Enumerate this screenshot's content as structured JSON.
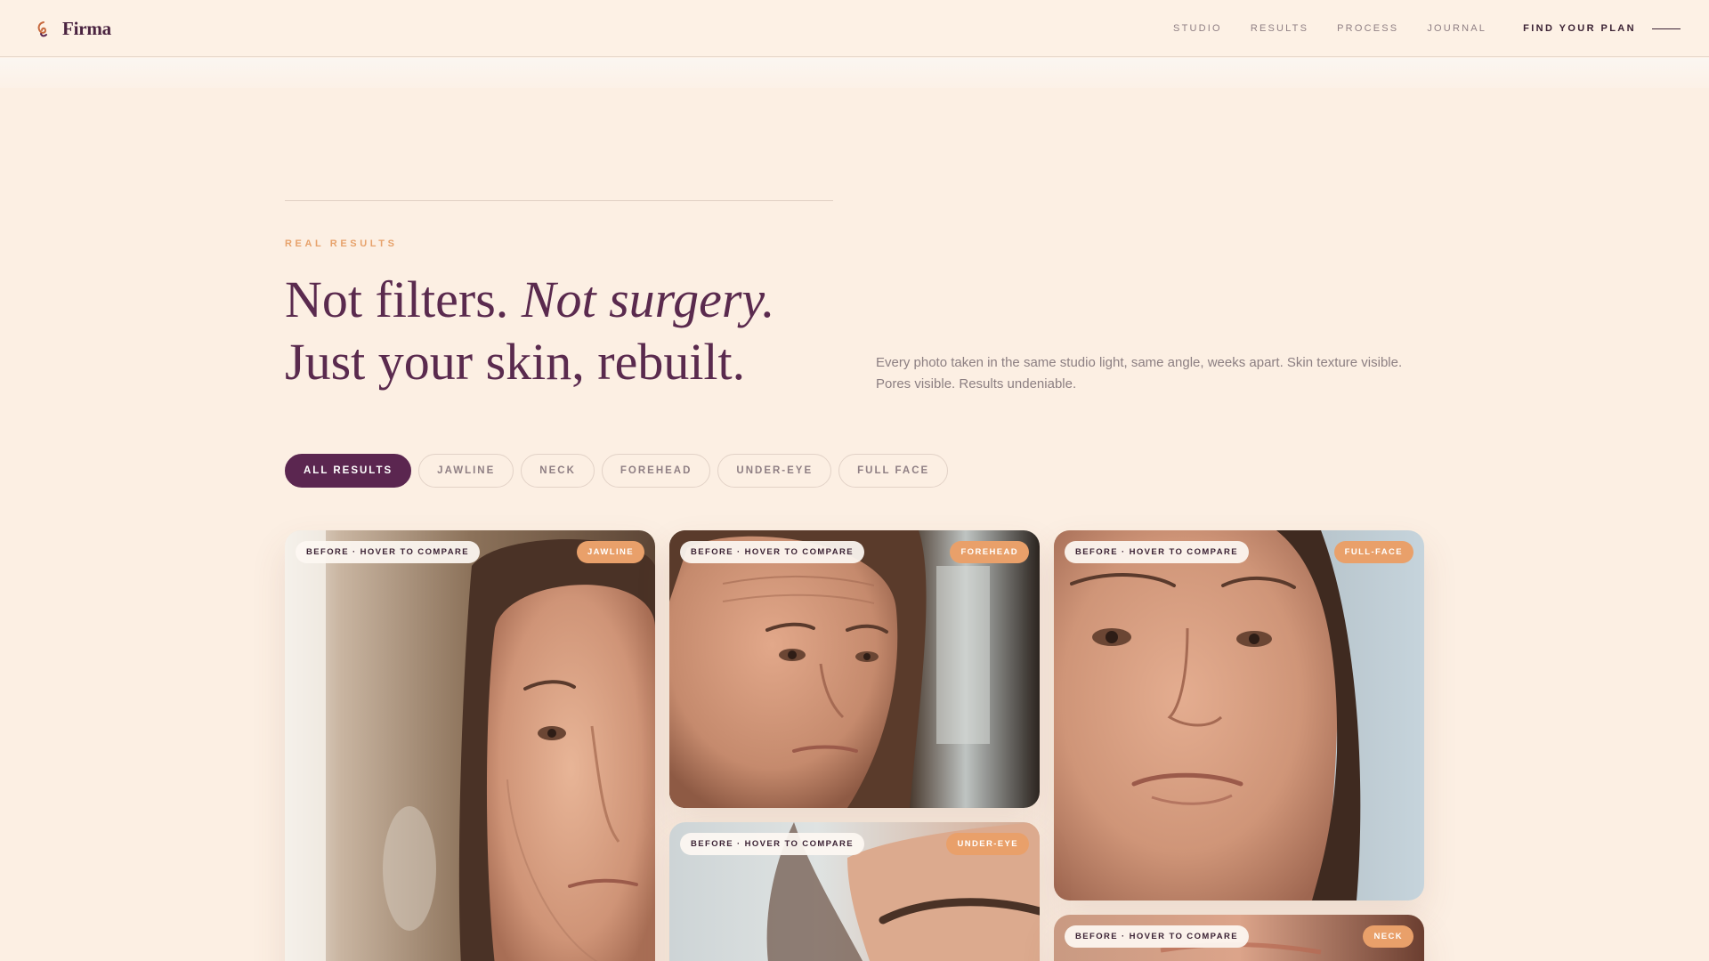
{
  "header": {
    "brand": "Firma",
    "nav": [
      "STUDIO",
      "RESULTS",
      "PROCESS",
      "JOURNAL"
    ],
    "cta": "FIND YOUR PLAN"
  },
  "hero": {
    "eyebrow": "REAL RESULTS",
    "headline_part1": "Not filters. ",
    "headline_italic": "Not surgery.",
    "headline_line2": "Just your skin, rebuilt.",
    "lede": "Every photo taken in the same studio light, same angle, weeks apart. Skin texture visible. Pores visible. Results undeniable."
  },
  "filters": [
    {
      "label": "ALL RESULTS",
      "active": true
    },
    {
      "label": "JAWLINE",
      "active": false
    },
    {
      "label": "NECK",
      "active": false
    },
    {
      "label": "FOREHEAD",
      "active": false
    },
    {
      "label": "UNDER-EYE",
      "active": false
    },
    {
      "label": "FULL FACE",
      "active": false
    }
  ],
  "cards": [
    {
      "pill": "BEFORE · HOVER TO COMPARE",
      "tag": "JAWLINE"
    },
    {
      "pill": "BEFORE · HOVER TO COMPARE",
      "tag": "FOREHEAD"
    },
    {
      "pill": "BEFORE · HOVER TO COMPARE",
      "tag": "FULL-FACE"
    },
    {
      "pill": "BEFORE · HOVER TO COMPARE",
      "tag": "UNDER-EYE"
    },
    {
      "pill": "BEFORE · HOVER TO COMPARE",
      "tag": "NECK"
    }
  ],
  "colors": {
    "background": "#fcefe3",
    "primary": "#5b2650",
    "accent": "#e9a06a",
    "muted": "#8f7f84"
  },
  "icons": {
    "brand": "firma-swirl-icon",
    "cta": "menu-line-icon"
  }
}
